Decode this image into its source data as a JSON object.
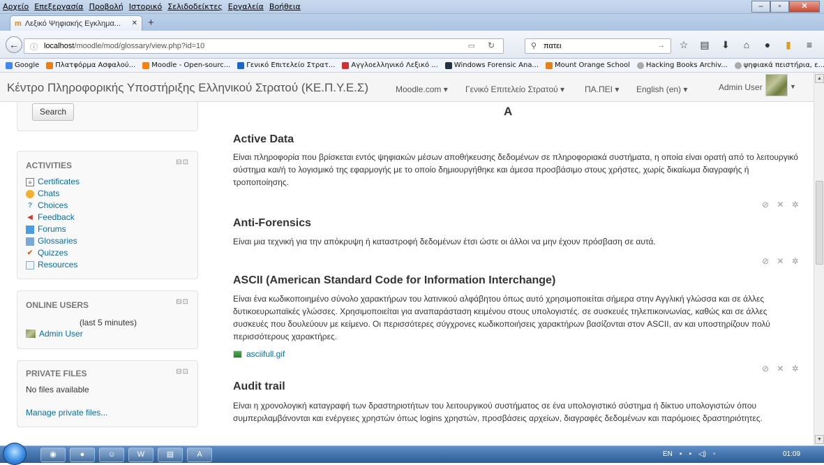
{
  "browser": {
    "menu": [
      "Αρχείο",
      "Επεξεργασία",
      "Προβολή",
      "Ιστορικό",
      "Σελιδοδείκτες",
      "Εργαλεία",
      "Βοήθεια"
    ],
    "tab_title": "Λεξικό Ψηφιακής Εγκλημα...",
    "url_host": "localhost",
    "url_path": "/moodle/mod/glossary/view.php?id=10",
    "search_value": "πατει",
    "bookmarks": [
      "Google",
      "Πλατφόρμα Ασφαλού...",
      "Moodle - Open-sourc...",
      "Γενικό Επιτελείο Στρατ...",
      "Αγγλοελληνικό Λεξικό ...",
      "Windows Forensic Ana...",
      "Mount Orange School",
      "Hacking Books Archiv...",
      "ψηφιακά πειστήρια, ε..."
    ],
    "bookmarks_overflow": "»"
  },
  "moodle": {
    "site_name": "Κέντρο Πληροφορικής Υποστήριξης Ελληνικού Στρατού (ΚΕ.Π.Υ.Ε.Σ)",
    "nav": [
      "Moodle.com ▾",
      "Γενικό Επιτελείο Στρατού ▾",
      "ΠΑ.ΠΕΙ ▾",
      "English (en) ▾"
    ],
    "user": "Admin User"
  },
  "blocks": {
    "search_button": "Search",
    "activities": {
      "title": "ACTIVITIES",
      "items": [
        "Certificates",
        "Chats",
        "Choices",
        "Feedback",
        "Forums",
        "Glossaries",
        "Quizzes",
        "Resources"
      ]
    },
    "online_users": {
      "title": "ONLINE USERS",
      "subtitle": "(last 5 minutes)",
      "user": "Admin User"
    },
    "private_files": {
      "title": "PRIVATE FILES",
      "empty": "No files available",
      "manage": "Manage private files..."
    }
  },
  "glossary": {
    "letter": "A",
    "entries": [
      {
        "title": "Active Data",
        "definition": "Είναι πληροφορία που βρίσκεται εντός ψηφιακών μέσων αποθήκευσης δεδομένων σε πληροφοριακά συστήματα, η οποία είναι ορατή από το λειτουργικό σύστημα και/ή το λογισμικό της εφαρμογής με το οποίο δημιουργήθηκε και άμεσα προσβάσιμο στους χρήστες, χωρίς δικαίωμα διαγραφής ή τροποποίησης."
      },
      {
        "title": "Anti-Forensics",
        "definition": "Είναι μια τεχνική για την απόκρυψη ή καταστροφή δεδομένων έτσι ώστε οι άλλοι να μην έχουν πρόσβαση σε αυτά."
      },
      {
        "title": "ASCII (American Standard Code for Information Interchange)",
        "definition": "Είναι ένα κωδικοποιημένο σύνολο χαρακτήρων του λατινικού αλφάβητου όπως αυτό χρησιμοποιείται σήμερα στην Αγγλική γλώσσα και σε άλλες δυτικοευρωπαϊκές γλώσσες. Χρησιμοποιείται για αναπαράσταση κειμένου στους υπολογιστές. σε συσκευές τηλεπικοινωνίας, καθώς και σε άλλες συσκευές που δουλεύουν με κείμενο. Οι περισσότερες σύγχρονες κωδικοποιήσεις χαρακτήρων βασίζονται στον ASCII, αν και υποστηρίζουν πολύ περισσότερους χαρακτήρες.",
        "attachment": "asciifull.gif"
      },
      {
        "title": "Audit trail",
        "definition": "Είναι η χρονολογική καταγραφή των δραστηριοτήτων του λειτουργικού συστήματος σε ένα υπολογιστικό σύστημα ή δίκτυο υπολογιστών όπου συμπεριλαμβάνονται και ενέργειες χρηστών όπως logins χρηστών, προσβάσεις αρχείων, διαγραφές δεδομένων και παρόμοιες δραστηριότητες."
      }
    ],
    "entry_actions": "⊘ ✕ ✲"
  },
  "taskbar": {
    "lang": "EN",
    "clock": "01:09"
  }
}
